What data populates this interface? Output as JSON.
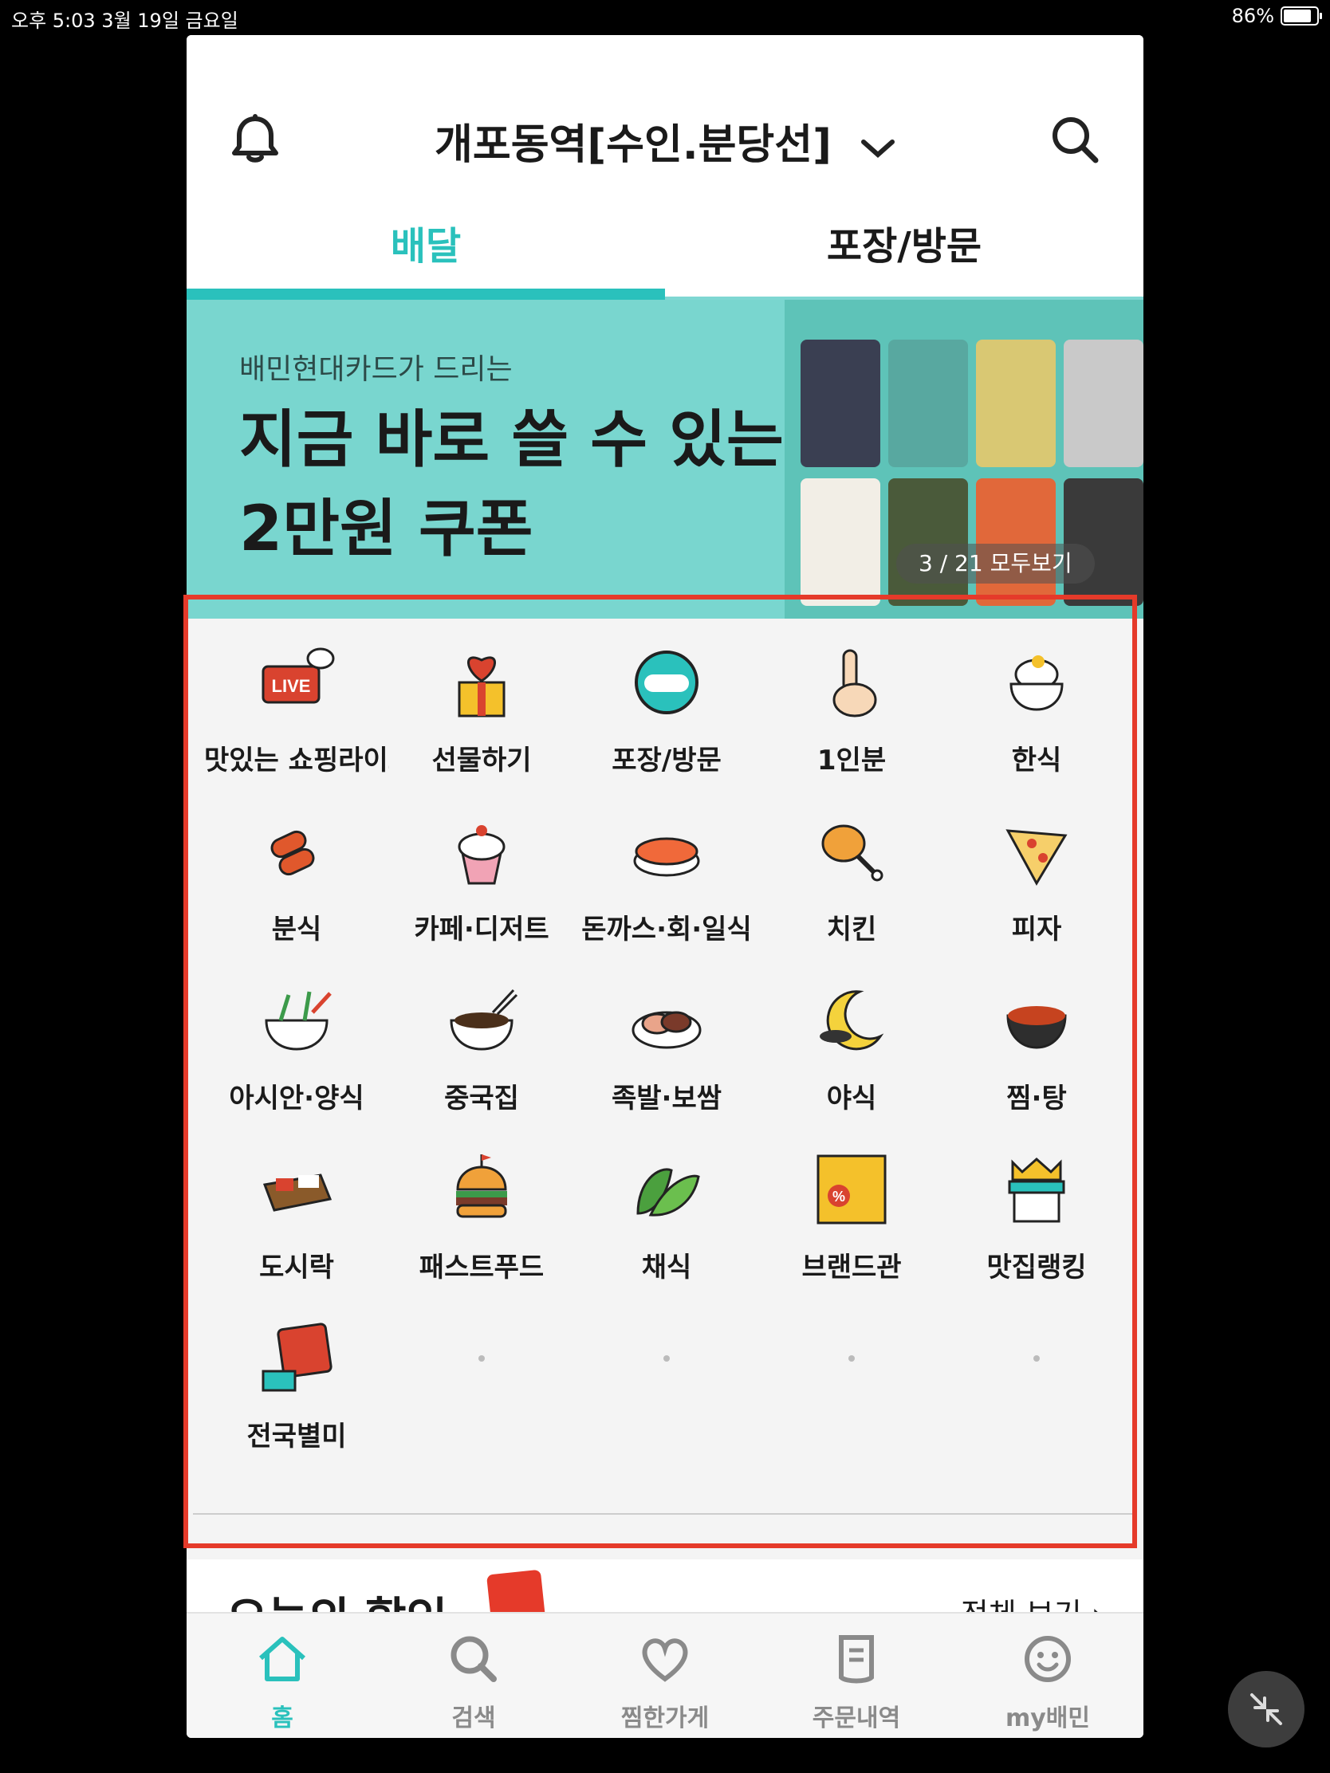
{
  "status_bar": {
    "time": "오후 5:03   3월 19일 금요일",
    "battery_pct": "86%",
    "battery_level": 0.86
  },
  "header": {
    "location": "개포동역[수인.분당선]"
  },
  "tabs": [
    {
      "label": "배달",
      "active": true
    },
    {
      "label": "포장/방문",
      "active": false
    }
  ],
  "banner": {
    "subtitle": "배민현대카드가 드리는",
    "title_line1": "지금 바로 쓸 수 있는",
    "title_line2": "2만원 쿠폰",
    "pager": "3 / 21  모두보기"
  },
  "categories": [
    {
      "label": "맛있는 쇼핑라이브",
      "icon": "live-icon"
    },
    {
      "label": "선물하기",
      "icon": "gift-icon"
    },
    {
      "label": "포장/방문",
      "icon": "takeout-icon"
    },
    {
      "label": "1인분",
      "icon": "one-finger-icon"
    },
    {
      "label": "한식",
      "icon": "rice-bowl-icon"
    },
    {
      "label": "분식",
      "icon": "tteokbokki-icon"
    },
    {
      "label": "카페·디저트",
      "icon": "cupcake-icon"
    },
    {
      "label": "돈까스·회·일식",
      "icon": "sushi-icon"
    },
    {
      "label": "치킨",
      "icon": "chicken-icon"
    },
    {
      "label": "피자",
      "icon": "pizza-icon"
    },
    {
      "label": "아시안·양식",
      "icon": "noodle-bowl-icon"
    },
    {
      "label": "중국집",
      "icon": "jjajang-icon"
    },
    {
      "label": "족발·보쌈",
      "icon": "jokbal-icon"
    },
    {
      "label": "야식",
      "icon": "moon-icon"
    },
    {
      "label": "찜·탕",
      "icon": "stew-pot-icon"
    },
    {
      "label": "도시락",
      "icon": "lunchbox-icon"
    },
    {
      "label": "패스트푸드",
      "icon": "burger-icon"
    },
    {
      "label": "채식",
      "icon": "leaf-icon"
    },
    {
      "label": "브랜드관",
      "icon": "brand-icon"
    },
    {
      "label": "맛집랭킹",
      "icon": "store-crown-icon"
    },
    {
      "label": "전국별미",
      "icon": "nationwide-icon"
    }
  ],
  "today": {
    "title": "오늘의 할인",
    "more": "전체 보기 ›"
  },
  "tabbar": [
    {
      "label": "홈",
      "icon": "home-icon",
      "active": true
    },
    {
      "label": "검색",
      "icon": "search-icon",
      "active": false
    },
    {
      "label": "찜한가게",
      "icon": "heart-icon",
      "active": false
    },
    {
      "label": "주문내역",
      "icon": "receipt-icon",
      "active": false
    },
    {
      "label": "my배민",
      "icon": "smile-icon",
      "active": false
    }
  ],
  "colors": {
    "accent": "#2ac1bc",
    "highlight": "#e53a2a",
    "banner": "#79d6cf"
  }
}
